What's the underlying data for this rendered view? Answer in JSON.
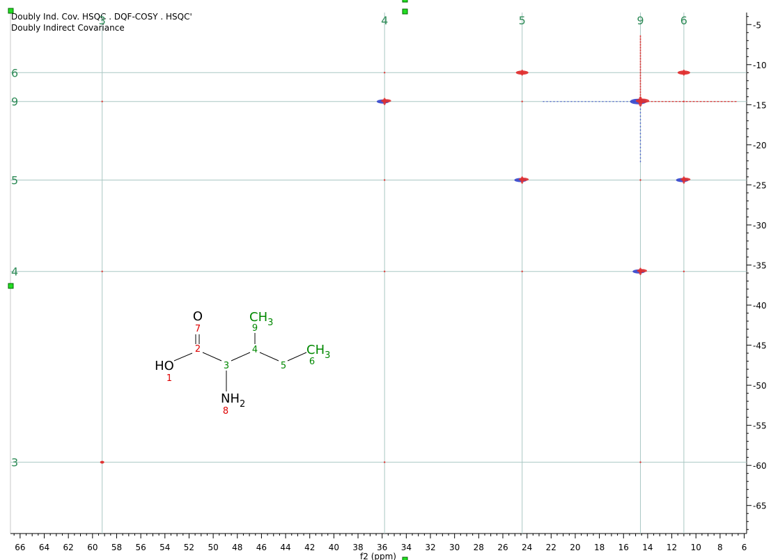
{
  "header": {
    "title": "Doubly Ind. Cov. HSQC . DQF-COSY . HSQC'",
    "subtitle": "Doubly Indirect Covariance"
  },
  "colors": {
    "positive": "#e03030",
    "negative": "#3344cc",
    "assignment": "#2e8b57",
    "gridline": "#a9c7c3",
    "atom_red": "#dd0000",
    "atom_green": "#008800"
  },
  "chart_data": {
    "type": "heatmap",
    "xlabel": "f2 (ppm)",
    "ylabel": "",
    "xlim": [
      66.8,
      5.8
    ],
    "ylim": [
      68.5,
      3.5
    ],
    "x_ticks": [
      66,
      64,
      62,
      60,
      58,
      56,
      54,
      52,
      50,
      48,
      46,
      44,
      42,
      40,
      38,
      36,
      34,
      32,
      30,
      28,
      26,
      24,
      22,
      20,
      18,
      16,
      14,
      12,
      10,
      8,
      6
    ],
    "y_ticks": [
      5,
      10,
      15,
      20,
      25,
      30,
      35,
      40,
      45,
      50,
      55,
      60,
      65
    ],
    "x_assignments": [
      {
        "label": "3",
        "ppm": 59.2
      },
      {
        "label": "4",
        "ppm": 35.8
      },
      {
        "label": "5",
        "ppm": 24.4
      },
      {
        "label": "9",
        "ppm": 14.6
      },
      {
        "label": "6",
        "ppm": 11.0
      }
    ],
    "y_assignments": [
      {
        "label": "6",
        "ppm": 11.0
      },
      {
        "label": "9",
        "ppm": 14.6
      },
      {
        "label": "5",
        "ppm": 24.4
      },
      {
        "label": "4",
        "ppm": 35.8
      },
      {
        "label": "3",
        "ppm": 59.6
      }
    ],
    "peaks": [
      {
        "x": 35.8,
        "y": 14.6,
        "sign": "mixed",
        "size": "medium"
      },
      {
        "x": 24.4,
        "y": 11.0,
        "sign": "positive",
        "size": "medium"
      },
      {
        "x": 24.4,
        "y": 24.4,
        "sign": "mixed",
        "size": "medium"
      },
      {
        "x": 14.6,
        "y": 14.6,
        "sign": "mixed",
        "size": "large"
      },
      {
        "x": 14.6,
        "y": 35.8,
        "sign": "mixed",
        "size": "medium"
      },
      {
        "x": 11.0,
        "y": 11.0,
        "sign": "positive",
        "size": "medium"
      },
      {
        "x": 11.0,
        "y": 24.4,
        "sign": "mixed",
        "size": "medium"
      },
      {
        "x": 59.2,
        "y": 59.6,
        "sign": "positive",
        "size": "small"
      },
      {
        "x": 59.2,
        "y": 14.6,
        "sign": "positive",
        "size": "tiny"
      },
      {
        "x": 59.2,
        "y": 35.8,
        "sign": "positive",
        "size": "tiny"
      },
      {
        "x": 35.8,
        "y": 11.0,
        "sign": "positive",
        "size": "tiny"
      },
      {
        "x": 35.8,
        "y": 24.4,
        "sign": "positive",
        "size": "tiny"
      },
      {
        "x": 35.8,
        "y": 35.8,
        "sign": "positive",
        "size": "tiny"
      },
      {
        "x": 35.8,
        "y": 59.6,
        "sign": "positive",
        "size": "tiny"
      },
      {
        "x": 24.4,
        "y": 14.6,
        "sign": "positive",
        "size": "tiny"
      },
      {
        "x": 24.4,
        "y": 35.8,
        "sign": "positive",
        "size": "tiny"
      },
      {
        "x": 14.6,
        "y": 24.4,
        "sign": "positive",
        "size": "tiny"
      },
      {
        "x": 14.6,
        "y": 59.6,
        "sign": "positive",
        "size": "tiny"
      },
      {
        "x": 11.0,
        "y": 14.6,
        "sign": "positive",
        "size": "tiny"
      },
      {
        "x": 11.0,
        "y": 35.8,
        "sign": "positive",
        "size": "tiny"
      }
    ],
    "molecule": {
      "labels": {
        "O": "O",
        "HO": "HO",
        "NH2_main": "NH",
        "NH2_sub": "2",
        "CH3_9_main": "CH",
        "CH3_9_sub": "3",
        "CH3_6_main": "CH",
        "CH3_6_sub": "3"
      },
      "atom_numbers": [
        {
          "label": "7",
          "color": "red"
        },
        {
          "label": "2",
          "color": "red"
        },
        {
          "label": "1",
          "color": "red"
        },
        {
          "label": "3",
          "color": "green"
        },
        {
          "label": "8",
          "color": "red"
        },
        {
          "label": "4",
          "color": "green"
        },
        {
          "label": "9",
          "color": "green"
        },
        {
          "label": "5",
          "color": "green"
        },
        {
          "label": "6",
          "color": "green"
        }
      ]
    }
  }
}
